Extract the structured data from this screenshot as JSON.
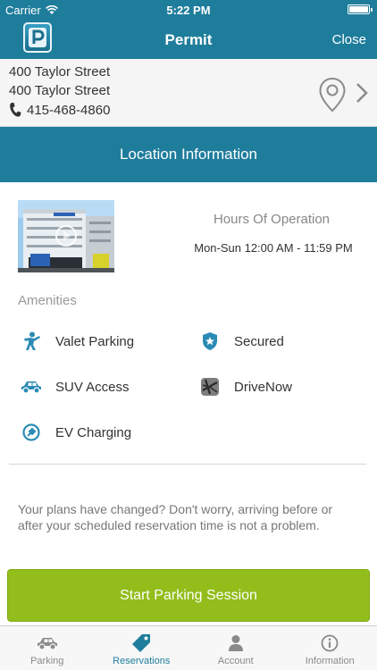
{
  "status_bar": {
    "carrier": "Carrier",
    "time": "5:22 PM"
  },
  "nav": {
    "title": "Permit",
    "close_label": "Close"
  },
  "location": {
    "address_line1": "400 Taylor Street",
    "address_line2": "400 Taylor Street",
    "phone": "415-468-4860"
  },
  "section": {
    "title": "Location Information"
  },
  "hours": {
    "title": "Hours Of Operation",
    "value": "Mon-Sun 12:00 AM - 11:59 PM"
  },
  "amenities": {
    "title": "Amenities",
    "items": [
      {
        "label": "Valet Parking",
        "icon": "valet-icon"
      },
      {
        "label": "Secured",
        "icon": "shield-star-icon"
      },
      {
        "label": "SUV Access",
        "icon": "car-icon"
      },
      {
        "label": "DriveNow",
        "icon": "drivenow-icon"
      },
      {
        "label": "EV Charging",
        "icon": "ev-charging-icon"
      }
    ]
  },
  "note": "Your plans have changed? Don't worry, arriving before or after your scheduled reservation time is not a problem.",
  "cta": {
    "label": "Start Parking Session"
  },
  "tabs": [
    {
      "label": "Parking",
      "icon": "car-icon"
    },
    {
      "label": "Reservations",
      "icon": "tag-icon"
    },
    {
      "label": "Account",
      "icon": "person-icon"
    },
    {
      "label": "Information",
      "icon": "info-icon"
    }
  ],
  "colors": {
    "brand": "#1f7d9c",
    "accent_green": "#92bd1b",
    "amenity_icon": "#2b8bb4"
  }
}
